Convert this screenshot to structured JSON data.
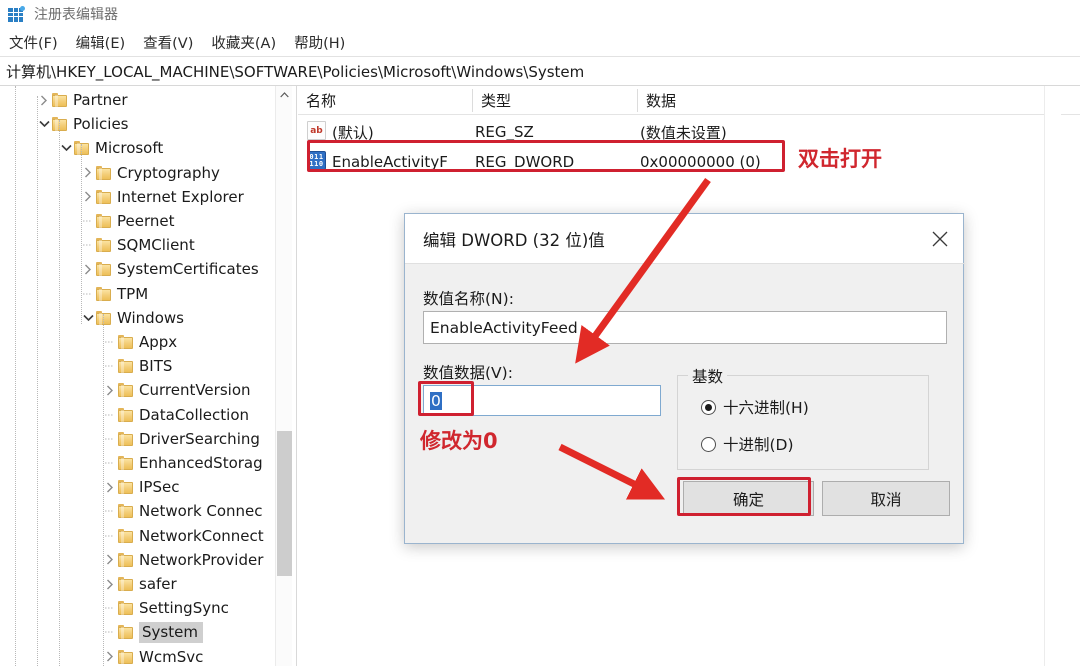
{
  "window": {
    "title": "注册表编辑器",
    "icon": "registry-editor-icon",
    "menu": [
      "文件(F)",
      "编辑(E)",
      "查看(V)",
      "收藏夹(A)",
      "帮助(H)"
    ],
    "address": "计算机\\HKEY_LOCAL_MACHINE\\SOFTWARE\\Policies\\Microsoft\\Windows\\System"
  },
  "tree": {
    "items": [
      {
        "label": "Partner",
        "indent": 1,
        "expander": "collapsed",
        "selected": false
      },
      {
        "label": "Policies",
        "indent": 1,
        "expander": "expanded",
        "selected": false
      },
      {
        "label": "Microsoft",
        "indent": 2,
        "expander": "expanded",
        "selected": false
      },
      {
        "label": "Cryptography",
        "indent": 3,
        "expander": "collapsed",
        "selected": false
      },
      {
        "label": "Internet Explorer",
        "indent": 3,
        "expander": "collapsed",
        "selected": false
      },
      {
        "label": "Peernet",
        "indent": 3,
        "expander": "none",
        "selected": false
      },
      {
        "label": "SQMClient",
        "indent": 3,
        "expander": "none",
        "selected": false
      },
      {
        "label": "SystemCertificates",
        "indent": 3,
        "expander": "collapsed",
        "selected": false
      },
      {
        "label": "TPM",
        "indent": 3,
        "expander": "none",
        "selected": false
      },
      {
        "label": "Windows",
        "indent": 3,
        "expander": "expanded",
        "selected": false
      },
      {
        "label": "Appx",
        "indent": 4,
        "expander": "none",
        "selected": false
      },
      {
        "label": "BITS",
        "indent": 4,
        "expander": "none",
        "selected": false
      },
      {
        "label": "CurrentVersion",
        "indent": 4,
        "expander": "collapsed",
        "selected": false
      },
      {
        "label": "DataCollection",
        "indent": 4,
        "expander": "none",
        "selected": false
      },
      {
        "label": "DriverSearching",
        "indent": 4,
        "expander": "none",
        "selected": false
      },
      {
        "label": "EnhancedStorag",
        "indent": 4,
        "expander": "none",
        "selected": false
      },
      {
        "label": "IPSec",
        "indent": 4,
        "expander": "collapsed",
        "selected": false
      },
      {
        "label": "Network Connec",
        "indent": 4,
        "expander": "none",
        "selected": false
      },
      {
        "label": "NetworkConnect",
        "indent": 4,
        "expander": "none",
        "selected": false
      },
      {
        "label": "NetworkProvider",
        "indent": 4,
        "expander": "collapsed",
        "selected": false
      },
      {
        "label": "safer",
        "indent": 4,
        "expander": "collapsed",
        "selected": false
      },
      {
        "label": "SettingSync",
        "indent": 4,
        "expander": "none",
        "selected": false
      },
      {
        "label": "System",
        "indent": 4,
        "expander": "none",
        "selected": true
      },
      {
        "label": "WcmSvc",
        "indent": 4,
        "expander": "collapsed",
        "selected": false
      }
    ]
  },
  "list": {
    "columns": [
      "名称",
      "类型",
      "数据"
    ],
    "rows": [
      {
        "icon": "string-value-icon",
        "name": "(默认)",
        "type": "REG_SZ",
        "data": "(数值未设置)",
        "highlighted": false
      },
      {
        "icon": "dword-value-icon",
        "name": "EnableActivityF",
        "type": "REG_DWORD",
        "data": "0x00000000 (0)",
        "highlighted": true
      }
    ]
  },
  "annotations": {
    "open_hint": "双击打开",
    "change_hint": "修改为0",
    "color": "#d0272e"
  },
  "dialog": {
    "title": "编辑 DWORD (32 位)值",
    "close_icon": "close-icon",
    "value_name_label": "数值名称(N):",
    "value_name": "EnableActivityFeed",
    "value_data_label": "数值数据(V):",
    "value_data": "0",
    "base_group_label": "基数",
    "radios": [
      {
        "label": "十六进制(H)",
        "checked": true
      },
      {
        "label": "十进制(D)",
        "checked": false
      }
    ],
    "ok_label": "确定",
    "cancel_label": "取消"
  }
}
